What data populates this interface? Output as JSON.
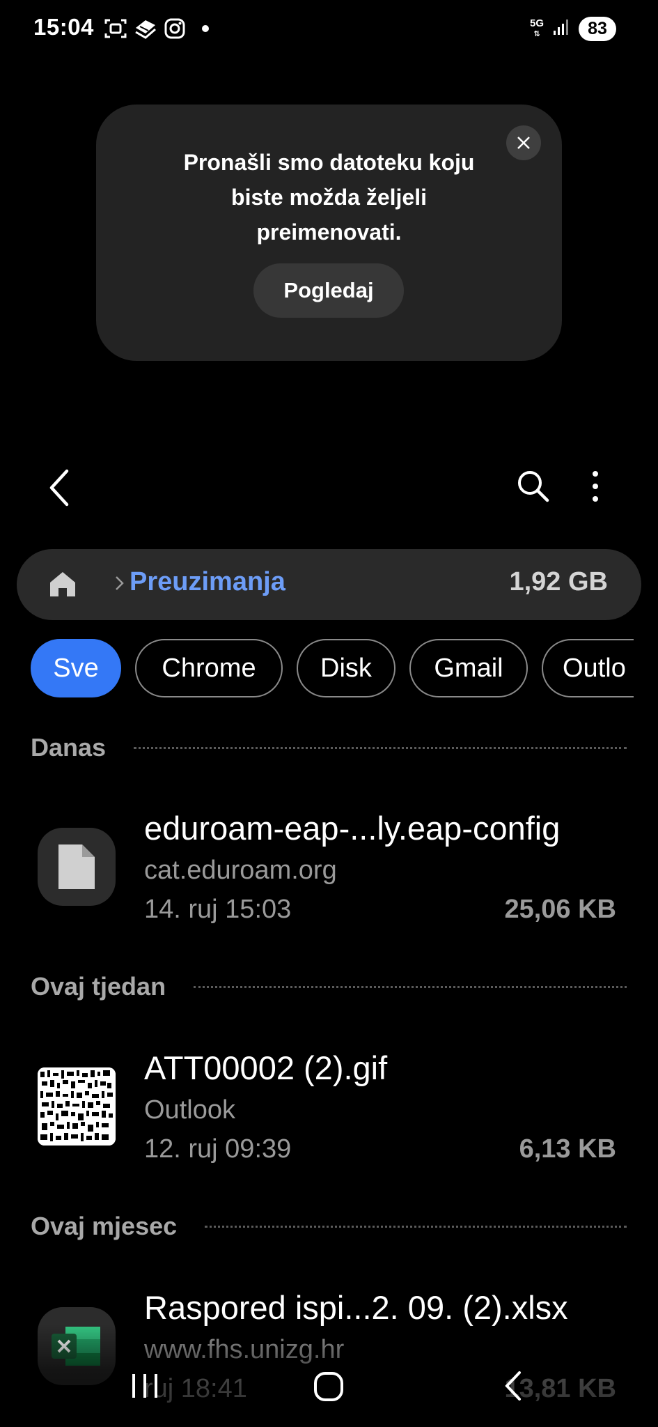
{
  "status_bar": {
    "time": "15:04",
    "network": "5G",
    "battery": "83",
    "icons": [
      "screenshot-icon",
      "app-icon",
      "instagram-icon",
      "notification-dot-icon",
      "signal-icon"
    ]
  },
  "popup": {
    "message": "Pronašli smo datoteku koju biste možda željeli preimenovati.",
    "action_label": "Pogledaj"
  },
  "toolbar": {
    "icons": [
      "back-icon",
      "search-icon",
      "more-options-icon"
    ]
  },
  "breadcrumb": {
    "folder": "Preuzimanja",
    "size": "1,92 GB"
  },
  "filters": [
    {
      "label": "Sve",
      "active": true
    },
    {
      "label": "Chrome",
      "active": false
    },
    {
      "label": "Disk",
      "active": false
    },
    {
      "label": "Gmail",
      "active": false
    },
    {
      "label": "Outlo",
      "active": false
    }
  ],
  "sections": [
    {
      "title": "Danas",
      "files": [
        {
          "name": "eduroam-eap-...ly.eap-config",
          "source": "cat.eduroam.org",
          "date": "14. ruj 15:03",
          "size": "25,06 KB",
          "icon": "document-icon"
        }
      ]
    },
    {
      "title": "Ovaj tjedan",
      "files": [
        {
          "name": "ATT00002 (2).gif",
          "source": "Outlook",
          "date": "12. ruj 09:39",
          "size": "6,13 KB",
          "icon": "gif-thumbnail"
        }
      ]
    },
    {
      "title": "Ovaj mjesec",
      "files": [
        {
          "name": "Raspored ispi...2. 09. (2).xlsx",
          "source": "www.fhs.unizg.hr",
          "date": "ruj 18:41",
          "size": "13,81 KB",
          "icon": "excel-icon"
        }
      ]
    }
  ],
  "nav_bar": {
    "icons": [
      "recent-apps-icon",
      "home-icon",
      "back-icon"
    ]
  },
  "colors": {
    "accent": "#3478f6",
    "breadcrumb_text": "#6d9df7",
    "background": "#000000",
    "popup_bg": "#232323",
    "excel_green": "#1f7a45"
  }
}
